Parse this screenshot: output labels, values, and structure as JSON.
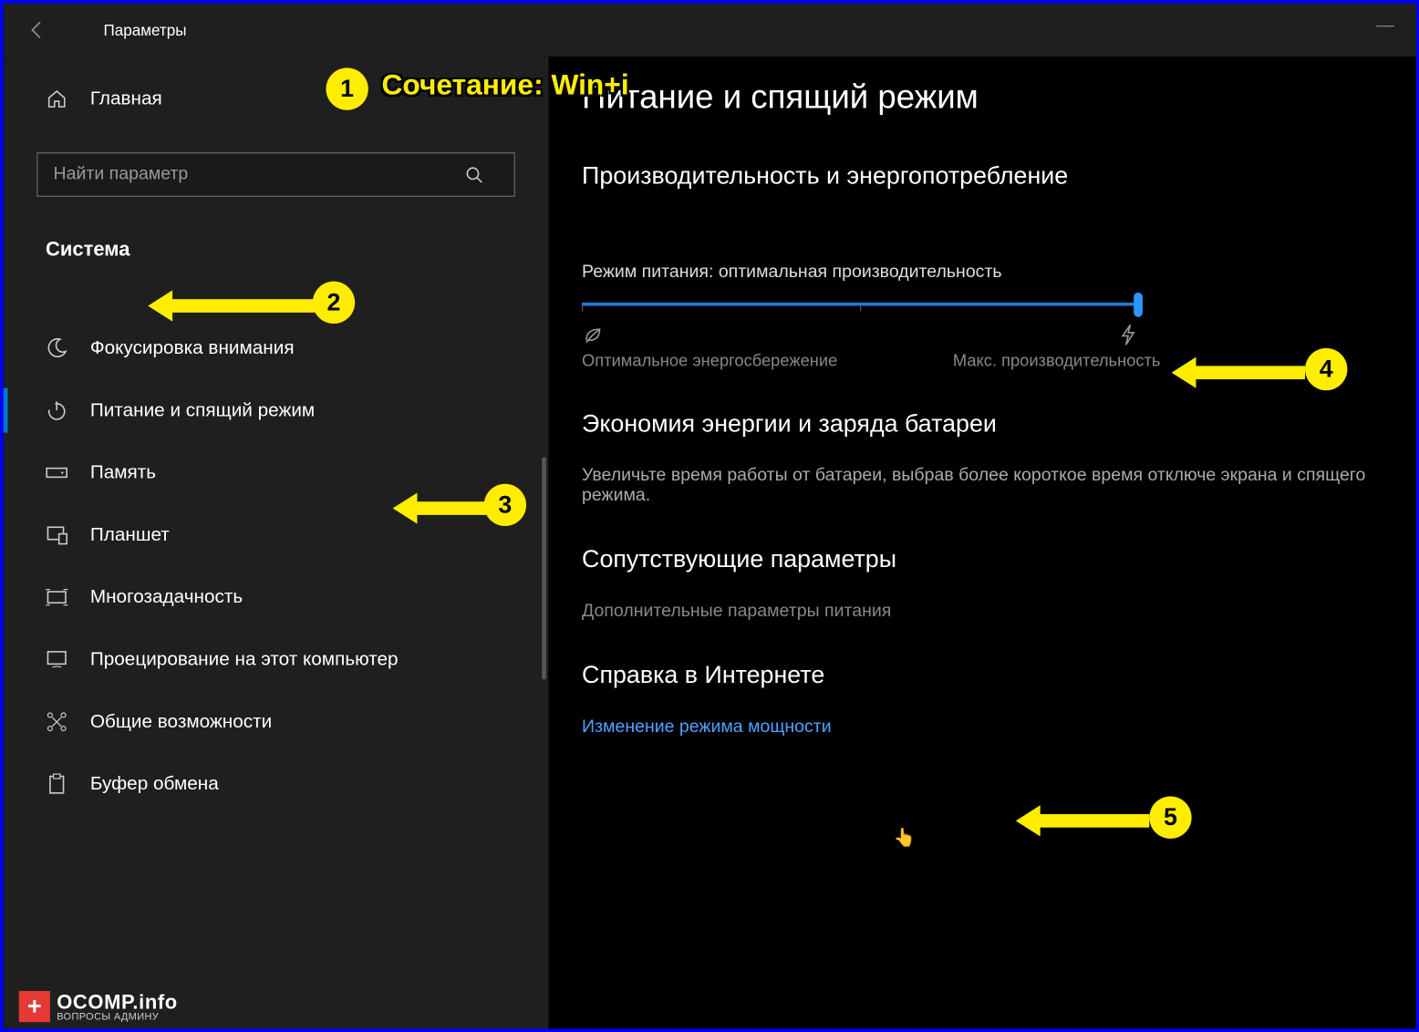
{
  "window": {
    "title": "Параметры"
  },
  "sidebar": {
    "home": "Главная",
    "search_placeholder": "Найти параметр",
    "category": "Система",
    "items": [
      {
        "label": "Фокусировка внимания"
      },
      {
        "label": "Питание и спящий режим"
      },
      {
        "label": "Память"
      },
      {
        "label": "Планшет"
      },
      {
        "label": "Многозадачность"
      },
      {
        "label": "Проецирование на этот компьютер"
      },
      {
        "label": "Общие возможности"
      },
      {
        "label": "Буфер обмена"
      }
    ]
  },
  "main": {
    "title": "Питание и спящий режим",
    "section1": {
      "heading": "Производительность и энергопотребление",
      "mode_label": "Режим питания: оптимальная производительность",
      "left_label": "Оптимальное энергосбережение",
      "right_label": "Макс. производительность"
    },
    "section2": {
      "heading": "Экономия энергии и заряда батареи",
      "text": "Увеличьте время работы от батареи, выбрав более короткое время отключе экрана и спящего режима."
    },
    "section3": {
      "heading": "Сопутствующие параметры",
      "link": "Дополнительные параметры питания"
    },
    "section4": {
      "heading": "Справка в Интернете",
      "link": "Изменение режима мощности"
    }
  },
  "annotations": {
    "a1_text": "Сочетание: Win+i",
    "a1": "1",
    "a2": "2",
    "a3": "3",
    "a4": "4",
    "a5": "5"
  },
  "watermark": {
    "main": "OCOMP.info",
    "sub": "ВОПРОСЫ АДМИНУ"
  }
}
